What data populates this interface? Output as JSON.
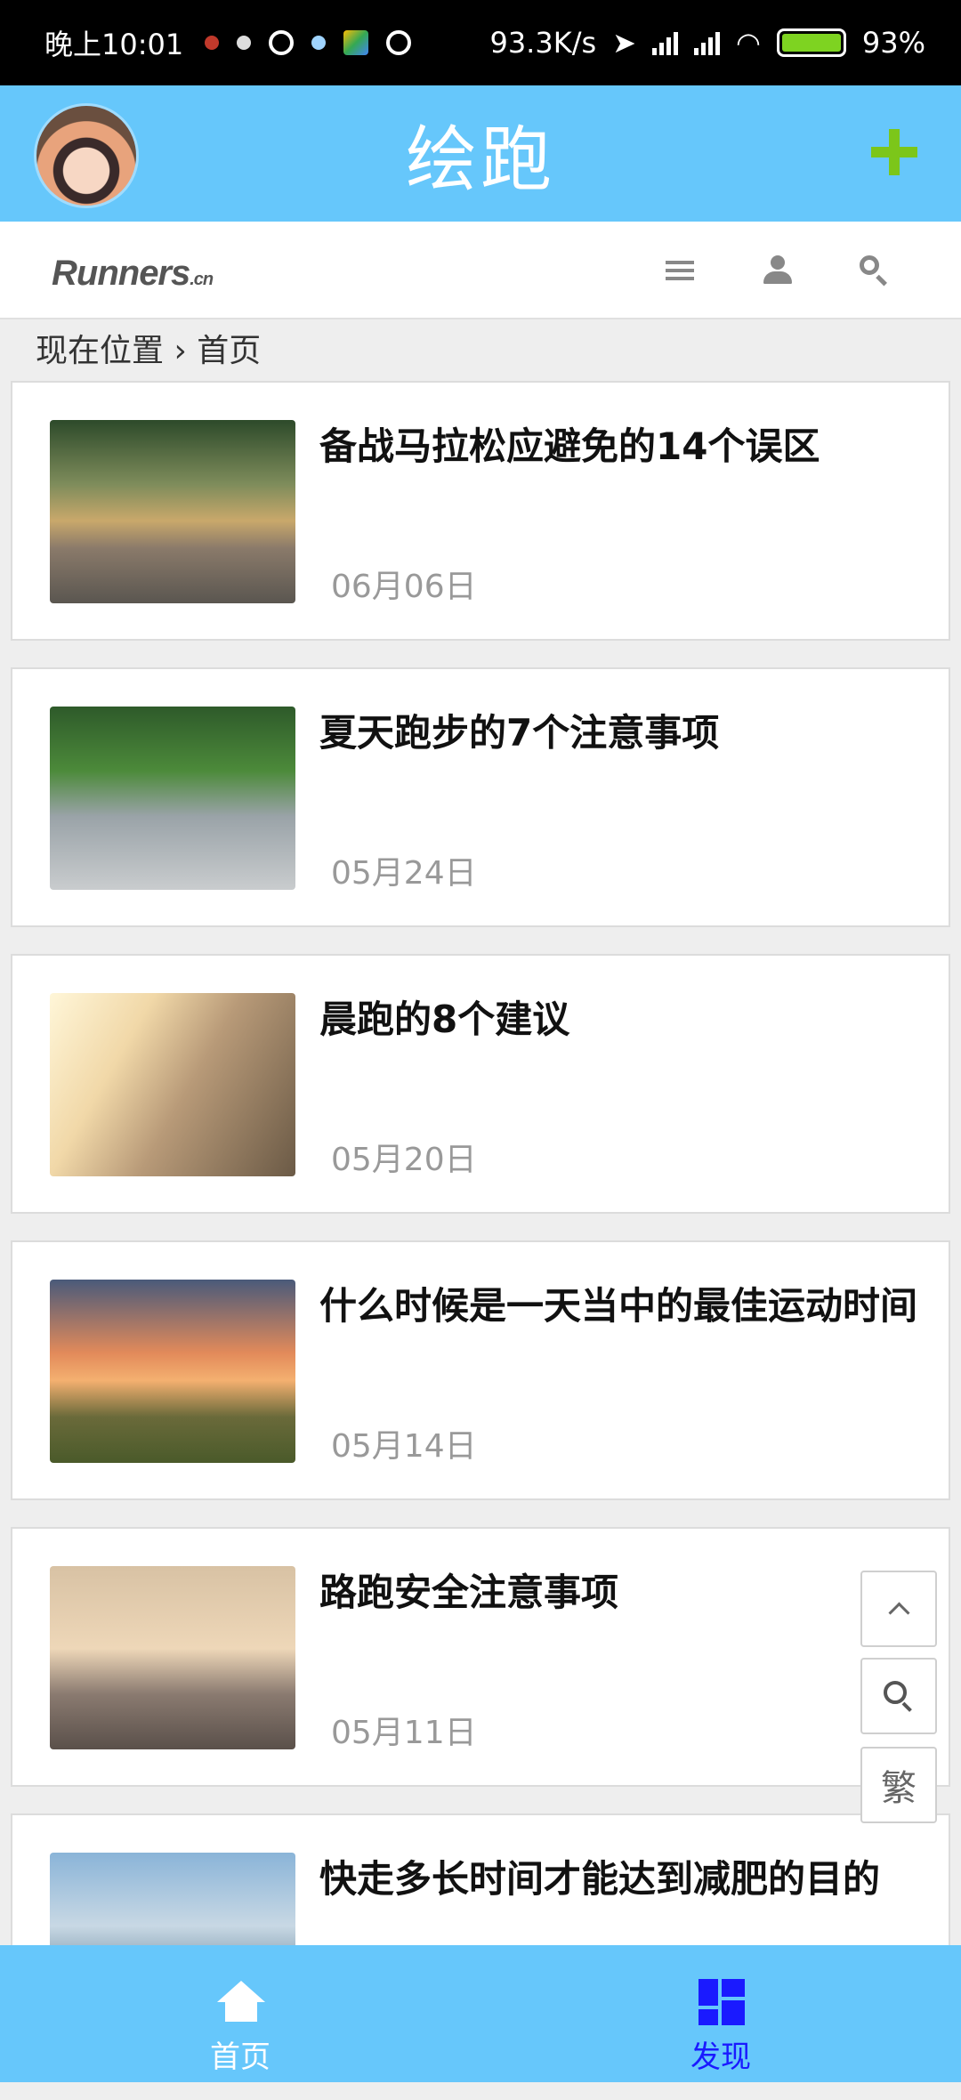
{
  "status_bar": {
    "time": "晚上10:01",
    "net_speed": "93.3K/s",
    "battery": "93%"
  },
  "header": {
    "title": "绘跑"
  },
  "site": {
    "logo_text": "Runners",
    "logo_suffix": ".cn"
  },
  "breadcrumb": {
    "label": "现在位置 › 首页"
  },
  "articles": [
    {
      "title": "备战马拉松应避免的14个误区",
      "date": "06月06日"
    },
    {
      "title": "夏天跑步的7个注意事项",
      "date": "05月24日"
    },
    {
      "title": "晨跑的8个建议",
      "date": "05月20日"
    },
    {
      "title": "什么时候是一天当中的最佳运动时间",
      "date": "05月14日"
    },
    {
      "title": "路跑安全注意事项",
      "date": "05月11日"
    },
    {
      "title": "快走多长时间才能达到减肥的目的",
      "date": ""
    }
  ],
  "floating": {
    "traditional_label": "繁"
  },
  "tabs": [
    {
      "label": "首页"
    },
    {
      "label": "发现"
    }
  ],
  "colors": {
    "header_bg": "#66c7fb",
    "add_icon": "#7cc61a",
    "active_tab": "#1a1aff"
  }
}
